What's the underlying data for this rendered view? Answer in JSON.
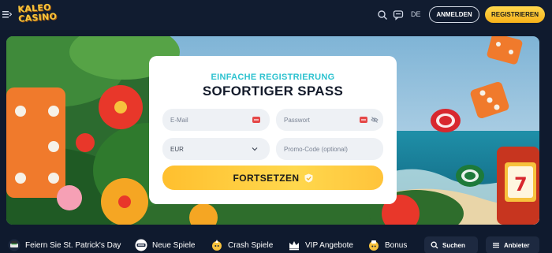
{
  "header": {
    "logo_line1": "KALEO",
    "logo_line2": "CASINO",
    "language": "DE",
    "login_label": "ANMELDEN",
    "register_label": "REGISTRIEREN"
  },
  "form": {
    "subtitle": "EINFACHE REGISTRIERUNG",
    "title": "SOFORTIGER SPASS",
    "email_placeholder": "E-Mail",
    "password_placeholder": "Passwort",
    "currency_value": "EUR",
    "promo_placeholder": "Promo-Code (optional)",
    "continue_label": "FORTSETZEN"
  },
  "categories": [
    {
      "label": "Feiern Sie St. Patrick's Day",
      "icon": "clover-icon"
    },
    {
      "label": "Neue Spiele",
      "icon": "new-games-icon"
    },
    {
      "label": "Crash Spiele",
      "icon": "crash-icon"
    },
    {
      "label": "VIP Angebote",
      "icon": "crown-icon"
    },
    {
      "label": "Bonus",
      "icon": "bonus-icon"
    }
  ],
  "search_label": "Suchen",
  "providers_label": "Anbieter",
  "colors": {
    "accent_yellow": "#ffd84d",
    "teal": "#2cc2cf",
    "header_bg": "#111c30"
  }
}
